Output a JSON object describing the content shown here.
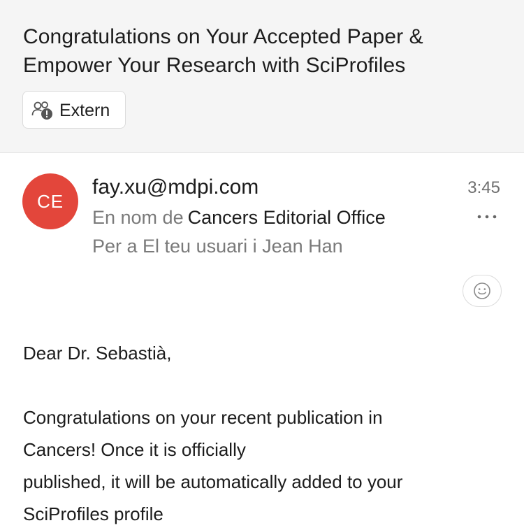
{
  "message": {
    "subject": "Congratulations on Your Accepted Paper & Empower Your Research with SciProfiles",
    "tag": {
      "label": "Extern",
      "icon": "people-warning-icon"
    },
    "sender": {
      "initials": "CE",
      "avatar_color": "#e3463b",
      "email": "fay.xu@mdpi.com",
      "on_behalf_prefix": "En nom de",
      "on_behalf_name": "Cancers Editorial Office",
      "recipients": "Per a El teu usuari i Jean Han"
    },
    "time": "3:45",
    "more_icon": "more-horizontal-icon",
    "react_icon": "smiley-icon",
    "body": {
      "greeting": "Dear Dr. Sebastià,",
      "lines": [
        "Congratulations on your recent publication in",
        "Cancers! Once it is officially",
        "published, it will be automatically added to your",
        "SciProfiles profile"
      ]
    }
  }
}
